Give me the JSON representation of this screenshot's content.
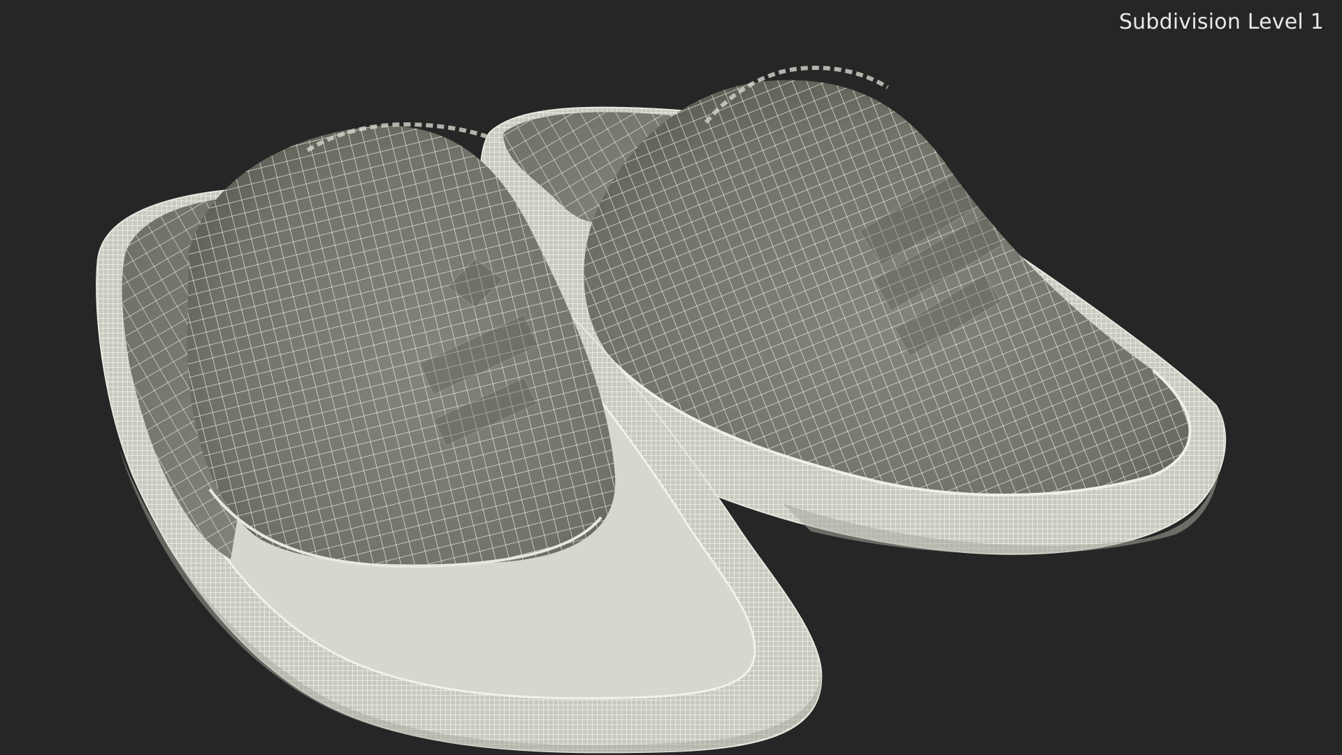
{
  "viewport": {
    "render_label": "Subdivision Level 1",
    "background_color": "#262626"
  },
  "model": {
    "object_count": 2,
    "objects": [
      {
        "id": "slipper-left"
      },
      {
        "id": "slipper-right"
      }
    ],
    "display_mode": "wireframe-on-shaded",
    "colors": {
      "surface": "#7c7c70",
      "surface_shadow": "#5e5f56",
      "wire": "#f1f1ea",
      "sole": "#cfcfc6",
      "sole_shadow": "#9c9c93"
    }
  }
}
